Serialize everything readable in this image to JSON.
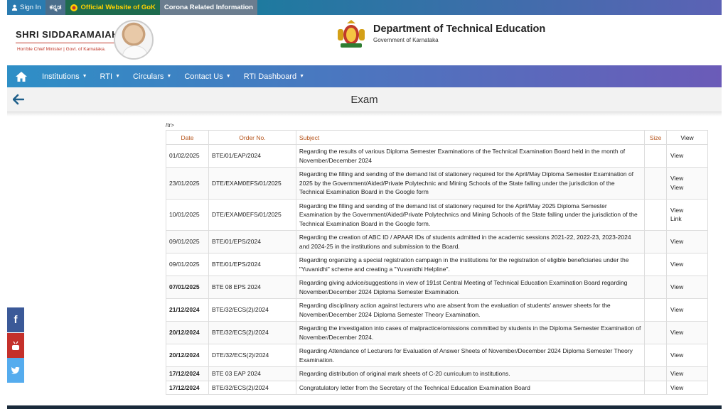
{
  "topbar": {
    "sign_in": "Sign In",
    "kannada": "ಕನ್ನಡ",
    "official": "Official Website of GoK",
    "corona": "Corona Related Information"
  },
  "header": {
    "cm_name": "SHRI SIDDARAMAIAH",
    "cm_subtitle": "Hon'ble Chief Minister | Govt. of Karnataka.",
    "dept_title": "Department of Technical Education",
    "dept_subtitle": "Government of Karnataka"
  },
  "nav": {
    "items": [
      "Institutions",
      "RTI",
      "Circulars",
      "Contact Us",
      "RTI Dashboard"
    ]
  },
  "page": {
    "title": "Exam",
    "stray_text": "/tr>"
  },
  "table": {
    "headers": {
      "date": "Date",
      "order": "Order No.",
      "subject": "Subject",
      "size": "Size",
      "view": "View"
    },
    "rows": [
      {
        "date": "01/02/2025",
        "bold": false,
        "order": "BTE/01/EAP/2024",
        "subject": "Regarding the results of various Diploma Semester Examinations of the Technical Examination Board held in the month of November/December 2024",
        "size": "",
        "view1": "View",
        "view2": ""
      },
      {
        "date": "23/01/2025",
        "bold": false,
        "order": "DTE/EXAM0EFS/01/2025",
        "subject": "Regarding the filling and sending of the demand list of stationery required for the April/May Diploma Semester Examination of 2025 by the Government/Aided/Private Polytechnic and Mining Schools of the State falling under the jurisdiction of the Technical Examination Board in the Google form",
        "size": "",
        "view1": "View",
        "view2": "View"
      },
      {
        "date": "10/01/2025",
        "bold": false,
        "order": "DTE/EXAM0EFS/01/2025",
        "subject": "Regarding the filling and sending of the demand list of stationery required for the April/May 2025 Diploma Semester Examination by the Government/Aided/Private Polytechnics and Mining Schools of the State falling under the jurisdiction of the Technical Examination Board in the Google form.",
        "size": "",
        "view1": "View",
        "view2": "Link"
      },
      {
        "date": "09/01/2025",
        "bold": false,
        "order": "BTE/01/EPS/2024",
        "subject": "Regarding the creation of ABC ID / APAAR IDs of students admitted in the academic sessions 2021-22, 2022-23, 2023-2024 and 2024-25 in the institutions and submission to the Board.",
        "size": "",
        "view1": "View",
        "view2": ""
      },
      {
        "date": "09/01/2025",
        "bold": false,
        "order": "BTE/01/EPS/2024",
        "subject": "Regarding organizing a special registration campaign in the institutions for the registration of eligible beneficiaries under the \"Yuvanidhi\" scheme and creating a \"Yuvanidhi Helpline\".",
        "size": "",
        "view1": "View",
        "view2": ""
      },
      {
        "date": "07/01/2025",
        "bold": true,
        "order": "BTE 08 EPS 2024",
        "subject": "Regarding giving advice/suggestions in view of 191st Central Meeting of Technical Education Examination Board regarding November/December 2024 Diploma Semester Examination.",
        "size": "",
        "view1": "View",
        "view2": ""
      },
      {
        "date": "21/12/2024",
        "bold": true,
        "order": "BTE/32/ECS(2)/2024",
        "subject": "Regarding disciplinary action against lecturers who are absent from the evaluation of students' answer sheets for the November/December 2024 Diploma Semester Theory Examination.",
        "size": "",
        "view1": "View",
        "view2": ""
      },
      {
        "date": "20/12/2024",
        "bold": true,
        "order": "BTE/32/ECS(2)/2024",
        "subject": "Regarding the investigation into cases of malpractice/omissions committed by students in the Diploma Semester Examination of November/December 2024.",
        "size": "",
        "view1": "View",
        "view2": ""
      },
      {
        "date": "20/12/2024",
        "bold": true,
        "order": "DTE/32/ECS(2)/2024",
        "subject": "Regarding Attendance of Lecturers for Evaluation of Answer Sheets of November/December 2024 Diploma Semester Theory Examination.",
        "size": "",
        "view1": "View",
        "view2": ""
      },
      {
        "date": "17/12/2024",
        "bold": true,
        "order": "BTE 03 EAP 2024",
        "subject": "Regarding distribution of original mark sheets of C-20 curriculum to institutions.",
        "size": "",
        "view1": "View",
        "view2": ""
      },
      {
        "date": "17/12/2024",
        "bold": true,
        "order": "BTE/32/ECS(2)/2024",
        "subject": "Congratulatory letter from the Secretary of the Technical Education Examination Board",
        "size": "",
        "view1": "View",
        "view2": ""
      }
    ]
  },
  "social": {
    "facebook_glyph": "f",
    "youtube_glyph": "You",
    "twitter_glyph": "🐦"
  },
  "colors": {
    "nav_start": "#2e8fc6",
    "nav_end": "#6b5bb8",
    "header_text_accent": "#b5541b",
    "facebook": "#3b5998",
    "youtube": "#c4302b",
    "twitter": "#55acee"
  }
}
